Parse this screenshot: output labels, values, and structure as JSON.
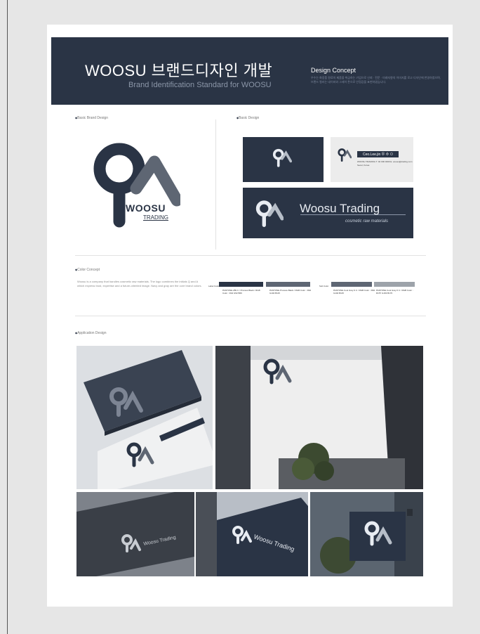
{
  "colors": {
    "navy": "#2a3445",
    "gray_dark": "#5e6673",
    "gray_light": "#9da3aa",
    "bg": "#e6e6e6"
  },
  "banner": {
    "title": "WOOSU 브랜드디자인 개발",
    "subtitle": "Brand Identification Standard for WOOSU",
    "concept_title": "Design Concept",
    "concept_text": "우수는 화장품 원료의 제품을 취급하는 기업으로 신뢰 · 전문 · 미래지향의 이미지를 로고 디자인에 반영하였으며, 브랜드 컬러는 네이비와 그레이 톤으로 안정감을 표현하였습니다."
  },
  "sections": {
    "basic_brand": "Basic Brand Design",
    "basic_design": "Basic Design",
    "color_concept": "Color Concept",
    "application": "Application Design"
  },
  "logo": {
    "word": "WOOSU",
    "sub": "TRADING"
  },
  "card": {
    "name": "Ceo.Lee.jin  우 수 ㅁ",
    "info": "WOOSU TRADING  T. 02 000 0000  E. woosu@trading.com  Seoul, Korea",
    "banner_title": "Woosu Trading",
    "banner_sub": "cosmetic raw materials"
  },
  "color_text": "Woosu is a company that handles cosmetic raw materials. The logo combines the initials Q and A which express trust, expertise and a future-oriented image. Navy and gray are the core brand colors.",
  "swatches": {
    "tag_a": "Label Color",
    "tag_b": "Sub Color",
    "items": [
      {
        "color": "#2a3445",
        "label": "PANTONE 289 C / Process Black / RGB Color : R42 G52 B69"
      },
      {
        "color": "#5e6673",
        "label": "PANTONE Process Black / RGB Color : R94 G102 B115"
      },
      {
        "color": "#5e6673",
        "label": "PANTONE Cool Gray 9 C / RGB Color : R94 G102 B115"
      },
      {
        "color": "#9da3aa",
        "label": "PANTONE Cool Gray 6 C / RGB Color : R157 G163 B170"
      }
    ]
  },
  "mockup": {
    "card_name": "Ceo.Lee.jin  우 수 ㅁ",
    "sign_text": "Woosu Trading",
    "stack_text": "Woosu Trading"
  }
}
